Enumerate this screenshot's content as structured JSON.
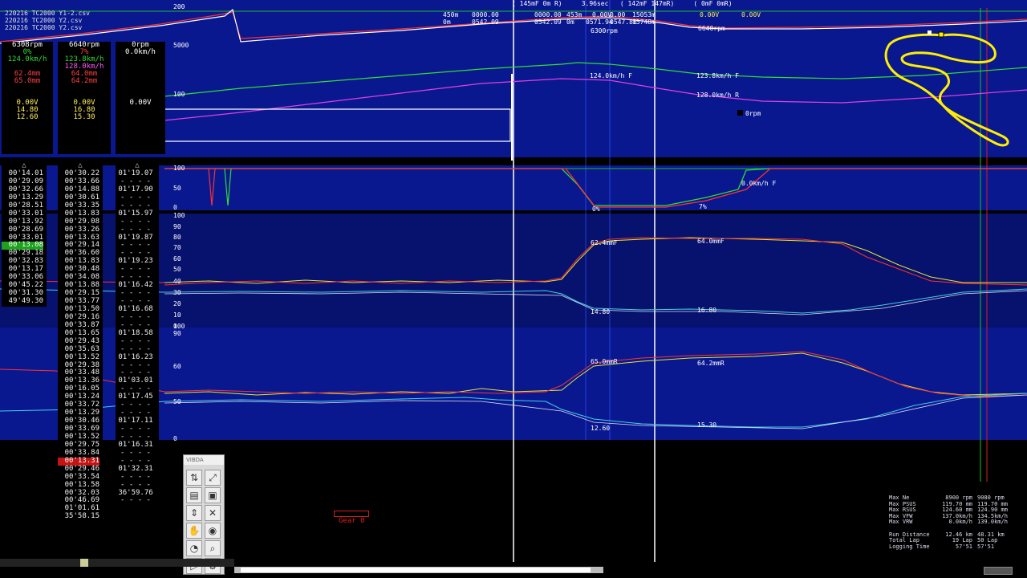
{
  "files": [
    "220216 TC2000 Y1-2.csv",
    "220216 TC2000 Y2.csv",
    "220216 TC2000 Y2.csv"
  ],
  "header": {
    "cursor_info": "( 145mF 0m R)     3.96sec   ( 142mF 147mR)     ( 0mF 0mR)",
    "row1": [
      "450m",
      "0000.00",
      "0000.00",
      "453m",
      "0.00V",
      "0.00",
      "15053m"
    ],
    "row2": [
      "0m",
      "0542.09",
      "0542.09",
      "0m",
      "0571.94",
      "0547.86",
      "15748m"
    ],
    "rpm_value": "6300rpm",
    "volt_a": "0.00V",
    "volt_b": "0.00V",
    "rpm_right": "6640rpm"
  },
  "chart_labels": {
    "speed_left": "124.0km/h F",
    "speed_right_1": "123.8km/h F",
    "speed_right_2": "128.0km/h R",
    "orpm": "0rpm",
    "throttle_speed": "0.0km/h F",
    "throttle_pct_a": "0%",
    "throttle_pct_b": "7%",
    "susp_f_left": "62.4mmF",
    "susp_f_right": "64.0mmF",
    "susp_val_a": "14.80",
    "susp_val_b": "16.80",
    "susp_r_left": "65.0mmR",
    "susp_r_right": "64.2mmR",
    "susp_val_c": "12.60",
    "susp_val_d": "15.30"
  },
  "axis_ticks": {
    "top": [
      "200",
      "5000",
      "100"
    ],
    "throttle": [
      "100",
      "50",
      "0"
    ],
    "front": [
      "100",
      "90",
      "80",
      "70",
      "60",
      "50",
      "40",
      "30",
      "20",
      "10",
      "0"
    ],
    "rear": [
      "100",
      "90",
      "60",
      "50",
      "0"
    ]
  },
  "panel_a": {
    "rpm": "6308rpm",
    "pct": "0%",
    "speed": "124.0km/h",
    "mm1": "62.4mm",
    "mm2": "65.0mm",
    "volt": "0.00V",
    "v1": "14.80",
    "v2": "12.60"
  },
  "panel_b": {
    "rpm": "6640rpm",
    "pct": "7%",
    "speed1": "123.8km/h",
    "speed2": "128.0km/h",
    "mm1": "64.0mm",
    "mm2": "64.2mm",
    "volt": "0.00V",
    "v1": "16.80",
    "v2": "15.30"
  },
  "panel_c": {
    "rpm": "0rpm",
    "speed": "0.0km/h",
    "volt": "0.00V"
  },
  "laps_a": [
    "00'14.01",
    "00'29.09",
    "00'32.66",
    "00'13.29",
    "00'28.51",
    "00'33.01",
    "00'13.92",
    "00'28.69",
    "00'33.01",
    "00'13.08",
    "00'29.18",
    "00'32.83",
    "00'13.17",
    "00'33.06",
    "00'45.22",
    "00'31.30",
    "49'49.30"
  ],
  "laps_b": [
    "00'30.22",
    "00'33.66",
    "00'14.88",
    "00'30.61",
    "00'33.35",
    "00'13.83",
    "00'29.08",
    "00'33.26",
    "00'13.63",
    "00'29.14",
    "00'36.60",
    "00'13.83",
    "00'30.48",
    "00'34.08",
    "00'13.88",
    "00'29.15",
    "00'33.77",
    "00'13.50",
    "00'29.16",
    "00'33.87",
    "00'13.65",
    "00'29.43",
    "00'35.63",
    "00'13.52",
    "00'29.38",
    "00'33.48",
    "00'13.36",
    "00'16.05",
    "00'13.24",
    "00'33.72",
    "00'13.29",
    "00'30.46",
    "00'33.69",
    "00'13.52",
    "00'29.75",
    "00'33.84",
    "00'13.31",
    "00'29.46",
    "00'33.54",
    "00'13.58",
    "00'32.03",
    "00'46.69",
    "01'01.61",
    "35'58.15"
  ],
  "laps_c": [
    "01'19.07",
    "- - - -",
    "01'17.90",
    "- - - -",
    "- - - -",
    "01'15.97",
    "- - - -",
    "- - - -",
    "01'19.87",
    "- - - -",
    "- - - -",
    "01'19.23",
    "- - - -",
    "- - - -",
    "01'16.42",
    "- - - -",
    "- - - -",
    "01'16.68",
    "- - - -",
    "- - - -",
    "01'18.58",
    "- - - -",
    "- - - -",
    "01'16.23",
    "- - - -",
    "- - - -",
    "01'03.01",
    "- - - -",
    "01'17.45",
    "- - - -",
    "- - - -",
    "01'17.11",
    "- - - -",
    "- - - -",
    "01'16.31",
    "- - - -",
    "- - - -",
    "01'32.31",
    "- - - -",
    "- - - -",
    "36'59.76",
    "- - - -"
  ],
  "gear_label": "Gear 0",
  "toolbox_title": "VIBDA",
  "stats": {
    "labels": [
      "Max Ne",
      "Max PSUS",
      "Max RSUS",
      "Max VFW",
      "Max VRW",
      "",
      "Run Distance",
      "Total Lap",
      "Logging Time"
    ],
    "col1": [
      "8900 rpm",
      "119.70 mm",
      "124.60 mm",
      "137.0km/h",
      "0.0km/h",
      "",
      "12.46 km",
      "19 Lap",
      "57'51"
    ],
    "col2": [
      "9080 rpm",
      "119.70 mm",
      "124.90 mm",
      "134.5km/h",
      "139.0km/h",
      "",
      "48.31 km",
      "50 Lap",
      "57'51"
    ]
  },
  "colors": {
    "bg_band_dark": "#07126e",
    "bg_band_light": "#0a1890",
    "red": "#ff2020",
    "green": "#22dd22",
    "cyan": "#40d0e8",
    "yellow": "#f0f040",
    "magenta": "#e040e0",
    "track": "#ffee00"
  }
}
